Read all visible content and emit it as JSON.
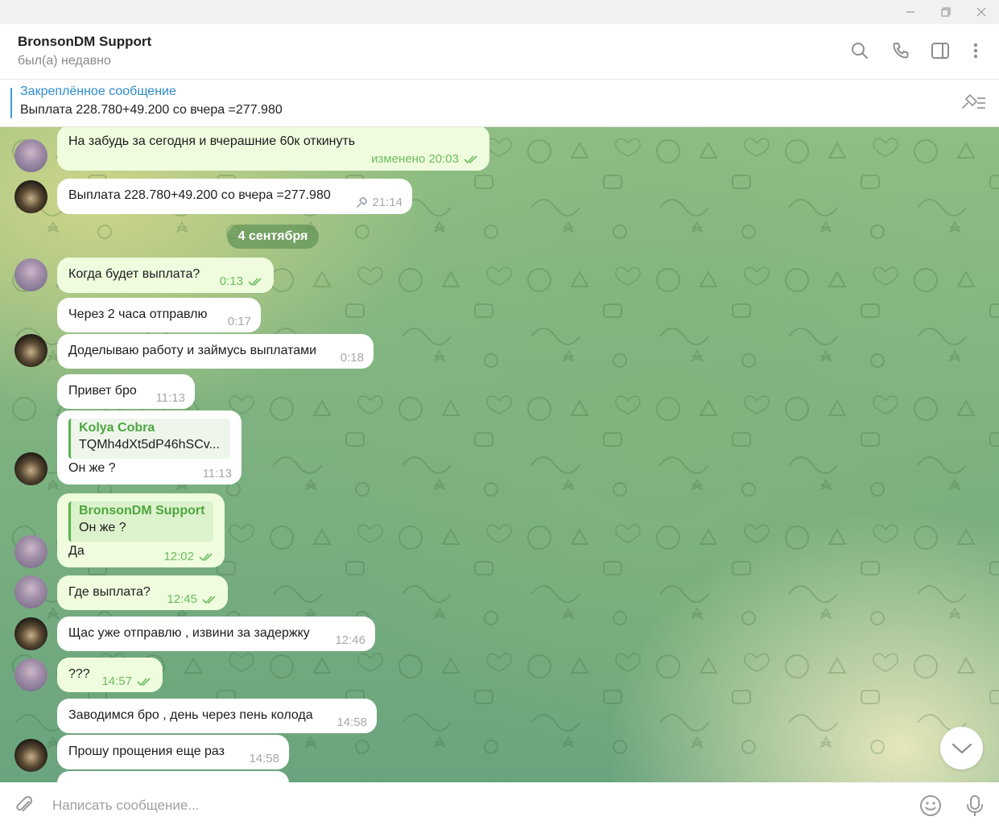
{
  "window": {
    "minimize_icon": "minimize-icon",
    "restore_icon": "restore-icon",
    "close_icon": "close-icon"
  },
  "header": {
    "name": "BronsonDM Support",
    "status": "был(а) недавно",
    "icons": [
      "search-icon",
      "phone-icon",
      "sidebar-toggle-icon",
      "more-vertical-icon"
    ]
  },
  "pinned": {
    "title": "Закреплённое сообщение",
    "text": "Выплата 228.780+49.200 со вчера =277.980",
    "icon": "pinned-list-icon"
  },
  "chat": {
    "date_separator": "4 сентября",
    "messages": [
      {
        "dir": "out",
        "text": "На забудь за сегодня и вчерашние 60к откинуть",
        "time": "изменено 20:03",
        "checks": "double"
      },
      {
        "dir": "in",
        "text": "Выплата 228.780+49.200 со вчера =277.980",
        "time": "21:14",
        "pinned": true
      },
      {
        "dir": "out",
        "text": "Когда будет выплата?",
        "time": "0:13",
        "checks": "double"
      },
      {
        "dir": "in",
        "text": "Через 2 часа отправлю",
        "time": "0:17"
      },
      {
        "dir": "in",
        "text": "Доделываю работу и займусь выплатами",
        "time": "0:18"
      },
      {
        "dir": "in",
        "text": "Привет бро",
        "time": "11:13"
      },
      {
        "dir": "in",
        "text": "Он же ?",
        "time": "11:13",
        "reply": {
          "name": "Kolya Cobra",
          "text": "TQMh4dXt5dP46hSCv..."
        }
      },
      {
        "dir": "out",
        "text": "Да",
        "time": "12:02",
        "checks": "double",
        "reply": {
          "name": "BronsonDM Support",
          "text": "Он же ?"
        }
      },
      {
        "dir": "out",
        "text": "Где выплата?",
        "time": "12:45",
        "checks": "double"
      },
      {
        "dir": "in",
        "text": "Щас уже отправлю , извини за задержку",
        "time": "12:46"
      },
      {
        "dir": "out",
        "text": "???",
        "time": "14:57",
        "checks": "double"
      },
      {
        "dir": "in",
        "text": "Заводимся бро , день через пень колода",
        "time": "14:58"
      },
      {
        "dir": "in",
        "text": "Прошу прощения еще раз",
        "time": "14:58"
      }
    ]
  },
  "composer": {
    "placeholder": "Написать сообщение...",
    "icons": [
      "attach-icon",
      "emoji-icon",
      "microphone-icon"
    ]
  },
  "colors": {
    "accent": "#2d8bcf",
    "outgoing_bubble": "#effdde",
    "incoming_bubble": "#ffffff",
    "read_checks": "#6dbb5f"
  }
}
